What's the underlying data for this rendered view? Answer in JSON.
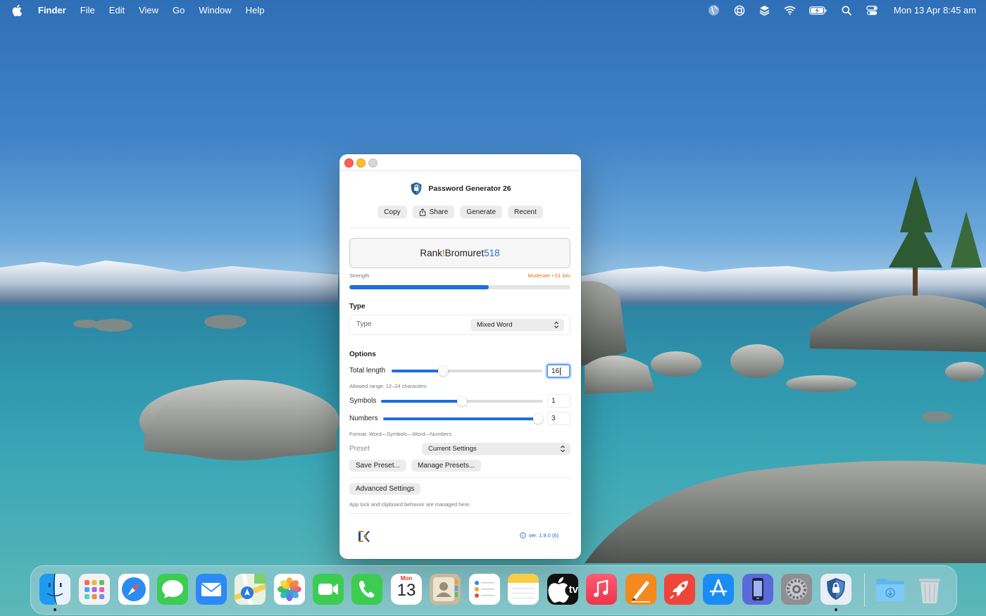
{
  "menubar": {
    "app_name": "Finder",
    "items": [
      "File",
      "Edit",
      "View",
      "Go",
      "Window",
      "Help"
    ],
    "clock": "Mon 13 Apr  8:45 am",
    "status_icons": [
      "globe-icon",
      "lifebuoy-icon",
      "layers-icon",
      "wifi-icon",
      "battery-charging-icon",
      "search-icon",
      "control-center-icon"
    ]
  },
  "window": {
    "title": "Password Generator 26",
    "toolbar": {
      "copy_label": "Copy",
      "share_label": "Share",
      "generate_label": "Generate",
      "recent_label": "Recent"
    },
    "password": {
      "word1": "Rank",
      "symbol": "!",
      "word2": "Bromuret",
      "number": "518"
    },
    "strength": {
      "label": "Strength",
      "value": "Moderate • 51 bits",
      "fraction": 0.63
    },
    "type_section": {
      "heading": "Type",
      "row_label": "Type",
      "selected": "Mixed Word"
    },
    "options": {
      "heading": "Options",
      "total_length": {
        "label": "Total length",
        "value": "16",
        "fraction": 0.34
      },
      "length_hint": "Allowed range: 12–24 characters",
      "symbols": {
        "label": "Symbols",
        "value": "1",
        "fraction": 0.5
      },
      "numbers": {
        "label": "Numbers",
        "value": "3",
        "fraction": 1.0
      },
      "format_hint": "Format: Word—Symbols—Word—Numbers",
      "preset_label": "Preset",
      "preset_selected": "Current Settings",
      "save_preset_label": "Save Preset...",
      "manage_presets_label": "Manage Presets..."
    },
    "advanced": {
      "button_label": "Advanced Settings",
      "hint": "App lock and clipboard behavior are managed here."
    },
    "footer": {
      "version": "ver. 1.9.0 (6)"
    }
  },
  "dock": {
    "apps": [
      "Finder",
      "Launchpad",
      "Safari",
      "Messages",
      "Mail",
      "Maps",
      "Photos",
      "FaceTime",
      "Phone",
      "Calendar",
      "Contacts",
      "Reminders",
      "Notes",
      "TV",
      "Music",
      "Pages",
      "Rocket",
      "App Store",
      "Simulator",
      "System Settings",
      "Password Generator",
      "Downloads",
      "Trash"
    ],
    "calendar_month": "Mon",
    "calendar_day": "13",
    "tv_label": "tv"
  },
  "colors": {
    "accent": "#1a6ee0",
    "strength_text": "#e07b12",
    "symbol": "#e0541f",
    "number": "#1f74d6"
  }
}
